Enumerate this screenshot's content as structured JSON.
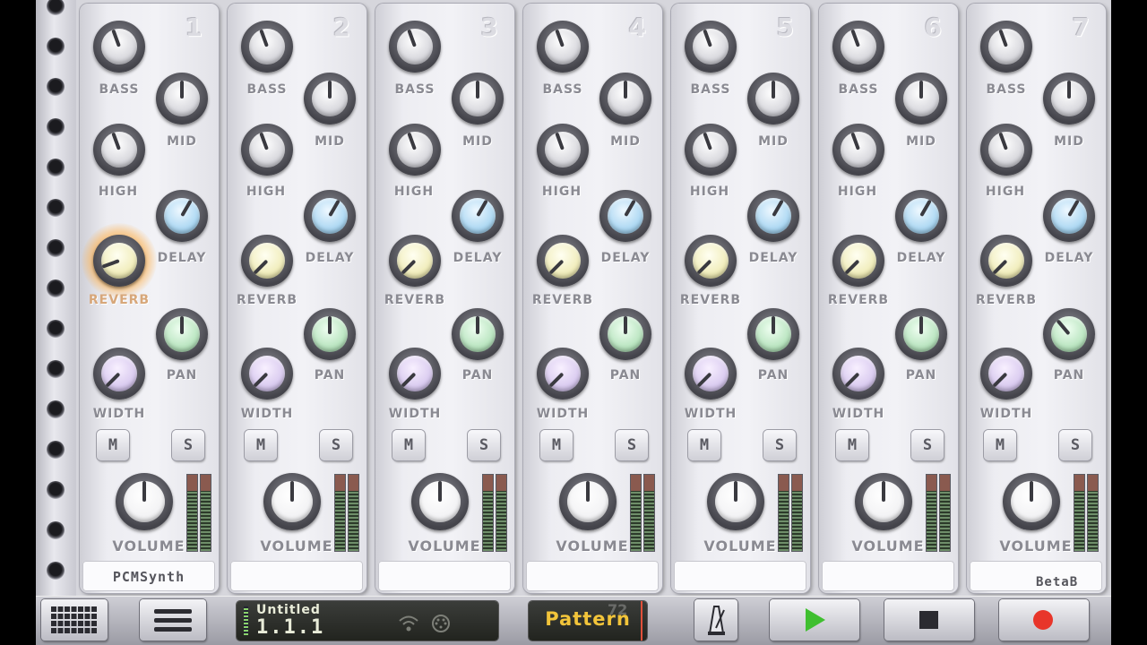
{
  "channels": [
    {
      "number": "1",
      "name": "PCMSynth"
    },
    {
      "number": "2",
      "name": ""
    },
    {
      "number": "3",
      "name": ""
    },
    {
      "number": "4",
      "name": ""
    },
    {
      "number": "5",
      "name": ""
    },
    {
      "number": "6",
      "name": ""
    },
    {
      "number": "7",
      "name": ""
    }
  ],
  "labels": {
    "bass": "BASS",
    "mid": "MID",
    "high": "HIGH",
    "delay": "DELAY",
    "reverb": "REVERB",
    "pan": "PAN",
    "width": "WIDTH",
    "volume": "VOLUME",
    "mute": "M",
    "solo": "S"
  },
  "version": "BetaB",
  "transport": {
    "song_title": "Untitled",
    "position": "1.1.1",
    "mode_label": "Pattern",
    "tempo": "72"
  },
  "icons": {
    "grid": "grid-icon",
    "menu": "menu-icon",
    "wifi": "wifi-icon",
    "midi": "midi-icon",
    "metronome": "metronome-icon",
    "play": "play-icon",
    "stop": "stop-icon",
    "record": "record-icon"
  },
  "colors": {
    "play": "#3fbf2f",
    "record": "#e8352a",
    "pattern_text": "#f2c43a",
    "active_glow": "#ffaa3c"
  }
}
